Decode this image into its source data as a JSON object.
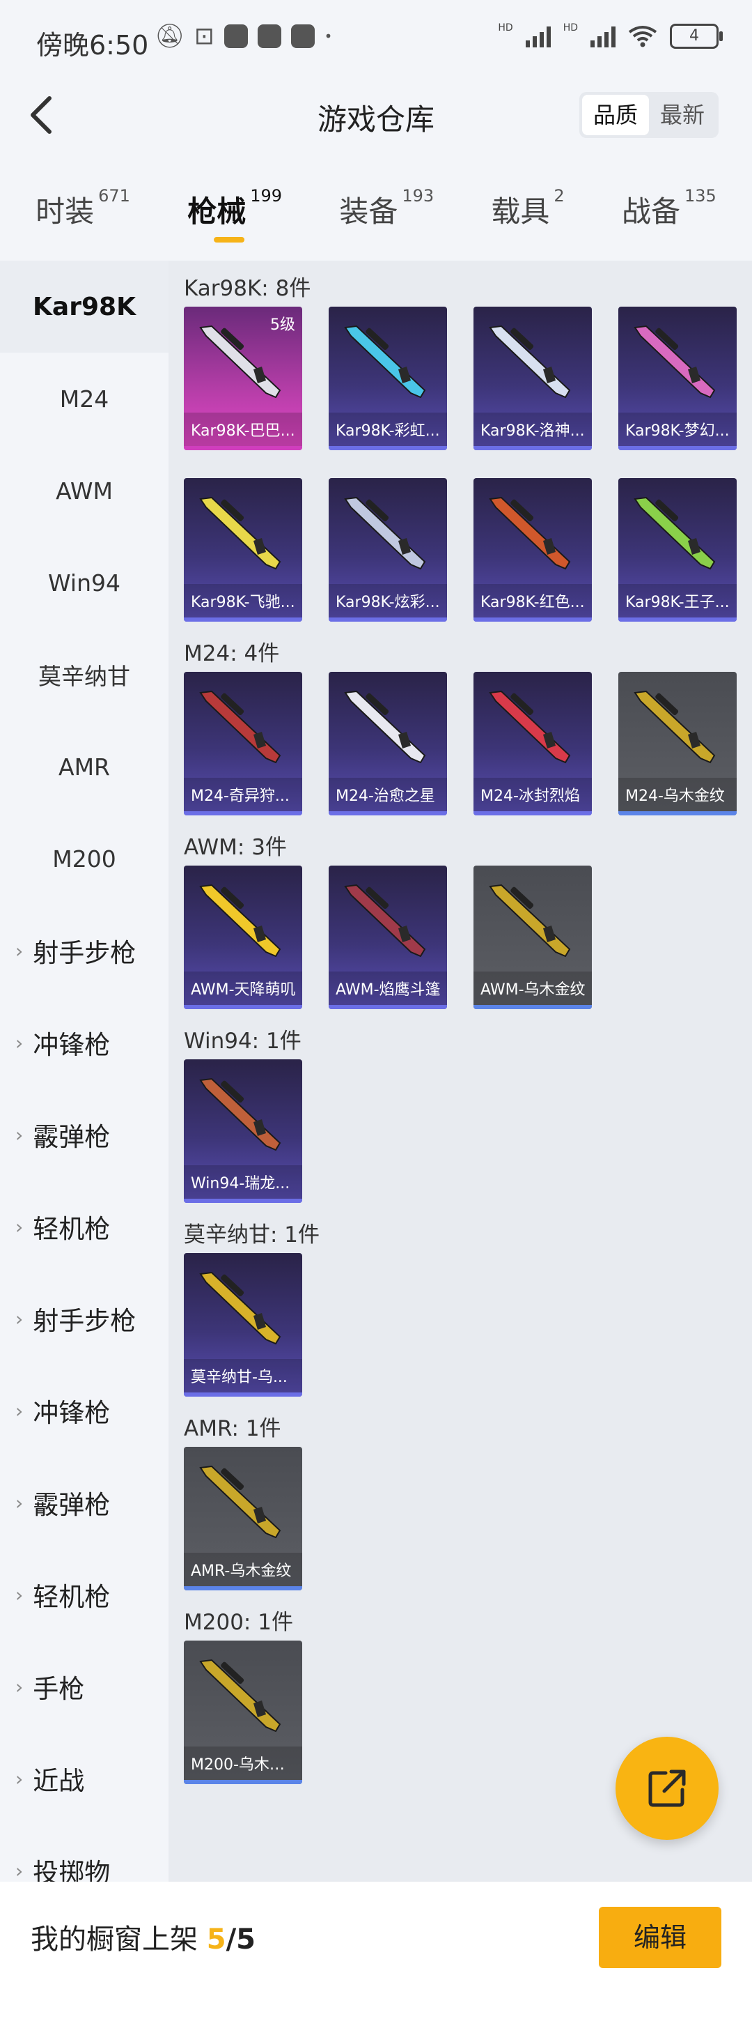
{
  "status_bar": {
    "time": "傍晚6:50",
    "battery": "4",
    "network_labels": [
      "HD",
      "HD"
    ]
  },
  "header": {
    "title": "游戏仓库",
    "sort_options": [
      {
        "label": "品质",
        "active": true
      },
      {
        "label": "最新",
        "active": false
      }
    ]
  },
  "tabs": [
    {
      "label": "时装",
      "count": "671",
      "active": false
    },
    {
      "label": "枪械",
      "count": "199",
      "active": true
    },
    {
      "label": "装备",
      "count": "193",
      "active": false
    },
    {
      "label": "载具",
      "count": "2",
      "active": false
    },
    {
      "label": "战备",
      "count": "135",
      "active": false
    }
  ],
  "sidebar": {
    "items": [
      {
        "label": "Kar98K",
        "active": true,
        "group": false
      },
      {
        "label": "M24",
        "active": false,
        "group": false
      },
      {
        "label": "AWM",
        "active": false,
        "group": false
      },
      {
        "label": "Win94",
        "active": false,
        "group": false
      },
      {
        "label": "莫辛纳甘",
        "active": false,
        "group": false
      },
      {
        "label": "AMR",
        "active": false,
        "group": false
      },
      {
        "label": "M200",
        "active": false,
        "group": false
      },
      {
        "label": "射手步枪",
        "active": false,
        "group": true
      },
      {
        "label": "冲锋枪",
        "active": false,
        "group": true
      },
      {
        "label": "霰弹枪",
        "active": false,
        "group": true
      },
      {
        "label": "轻机枪",
        "active": false,
        "group": true
      },
      {
        "label": "射手步枪",
        "active": false,
        "group": true
      },
      {
        "label": "冲锋枪",
        "active": false,
        "group": true
      },
      {
        "label": "霰弹枪",
        "active": false,
        "group": true
      },
      {
        "label": "轻机枪",
        "active": false,
        "group": true
      },
      {
        "label": "手枪",
        "active": false,
        "group": true
      },
      {
        "label": "近战",
        "active": false,
        "group": true
      },
      {
        "label": "投掷物",
        "active": false,
        "group": true
      }
    ]
  },
  "sections": [
    {
      "title": "Kar98K: 8件",
      "items": [
        {
          "name": "Kar98K-巴巴...",
          "level": "5级",
          "rarity": "legendary",
          "gun_color": "#e0e0e8"
        },
        {
          "name": "Kar98K-彩虹...",
          "level": "",
          "rarity": "epic",
          "gun_color": "#4ac6e8"
        },
        {
          "name": "Kar98K-洛神...",
          "level": "",
          "rarity": "epic",
          "gun_color": "#d8e0f0"
        },
        {
          "name": "Kar98K-梦幻...",
          "level": "",
          "rarity": "epic",
          "gun_color": "#d86ac0"
        },
        {
          "name": "Kar98K-飞驰...",
          "level": "",
          "rarity": "epic",
          "gun_color": "#e8d84a"
        },
        {
          "name": "Kar98K-炫彩...",
          "level": "",
          "rarity": "epic",
          "gun_color": "#c0c8e0"
        },
        {
          "name": "Kar98K-红色...",
          "level": "",
          "rarity": "epic",
          "gun_color": "#d0582c"
        },
        {
          "name": "Kar98K-王子...",
          "level": "",
          "rarity": "epic",
          "gun_color": "#8ad04a"
        }
      ]
    },
    {
      "title": "M24: 4件",
      "items": [
        {
          "name": "M24-奇异狩...",
          "level": "",
          "rarity": "epic",
          "gun_color": "#b83a3a"
        },
        {
          "name": "M24-治愈之星",
          "level": "",
          "rarity": "epic",
          "gun_color": "#e8e8f0"
        },
        {
          "name": "M24-冰封烈焰",
          "level": "",
          "rarity": "epic",
          "gun_color": "#d83a4a"
        },
        {
          "name": "M24-乌木金纹",
          "level": "",
          "rarity": "gray",
          "gun_color": "#c9a72a"
        }
      ]
    },
    {
      "title": "AWM: 3件",
      "items": [
        {
          "name": "AWM-天降萌叽",
          "level": "",
          "rarity": "epic",
          "gun_color": "#f0c82a"
        },
        {
          "name": "AWM-焰鹰斗篷",
          "level": "",
          "rarity": "epic",
          "gun_color": "#a03a4a"
        },
        {
          "name": "AWM-乌木金纹",
          "level": "",
          "rarity": "gray",
          "gun_color": "#c9a72a"
        }
      ]
    },
    {
      "title": "Win94: 1件",
      "items": [
        {
          "name": "Win94-瑞龙...",
          "level": "",
          "rarity": "epic",
          "gun_color": "#c0603a"
        }
      ]
    },
    {
      "title": "莫辛纳甘: 1件",
      "items": [
        {
          "name": "莫辛纳甘-乌...",
          "level": "",
          "rarity": "epic",
          "gun_color": "#d8b22a"
        }
      ]
    },
    {
      "title": "AMR: 1件",
      "items": [
        {
          "name": "AMR-乌木金纹",
          "level": "",
          "rarity": "gray",
          "gun_color": "#c9a72a"
        }
      ]
    },
    {
      "title": "M200: 1件",
      "items": [
        {
          "name": "M200-乌木金...",
          "level": "",
          "rarity": "gray",
          "gun_color": "#c9a72a"
        }
      ]
    }
  ],
  "bottom_bar": {
    "showcase_label": "我的橱窗上架",
    "showcase_used": "5",
    "showcase_sep": "/",
    "showcase_total": "5",
    "edit_label": "编辑"
  },
  "fab": {
    "icon": "share-out-icon"
  },
  "colors": {
    "accent": "#f6b318",
    "edit_button": "#f8ad10",
    "legendary": "#e548c8",
    "epic": "#5a4fb5",
    "gray": "#5d5f65"
  }
}
